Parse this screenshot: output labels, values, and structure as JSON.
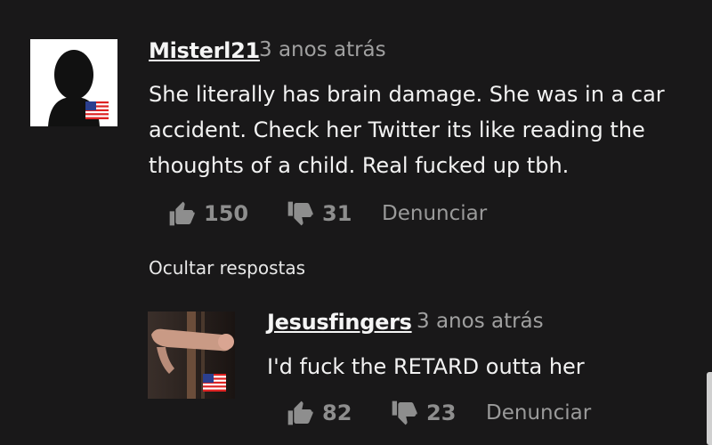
{
  "comments": [
    {
      "username": "Misterl21",
      "time": "3 anos atrás",
      "body_lines": [
        "She literally has brain damage. She was in a car",
        "accident. Check her Twitter its like reading the",
        "thoughts of a child. Real fucked up tbh."
      ],
      "likes": "150",
      "dislikes": "31",
      "report_label": "Denunciar",
      "avatar_icon": "default-silhouette-avatar",
      "flag_icon": "us-flag-icon"
    },
    {
      "username": "Jesusfingers",
      "time": "3 anos atrás",
      "body_lines": [
        "I'd fuck the RETARD outta her"
      ],
      "likes": "82",
      "dislikes": "23",
      "report_label": "Denunciar",
      "avatar_icon": "user-photo-avatar",
      "flag_icon": "us-flag-icon"
    }
  ],
  "replies_toggle": "Ocultar respostas",
  "colors": {
    "background": "#191819",
    "text": "#f2f2f2",
    "muted": "#a0a0a0",
    "icon": "#8e8e8e"
  }
}
